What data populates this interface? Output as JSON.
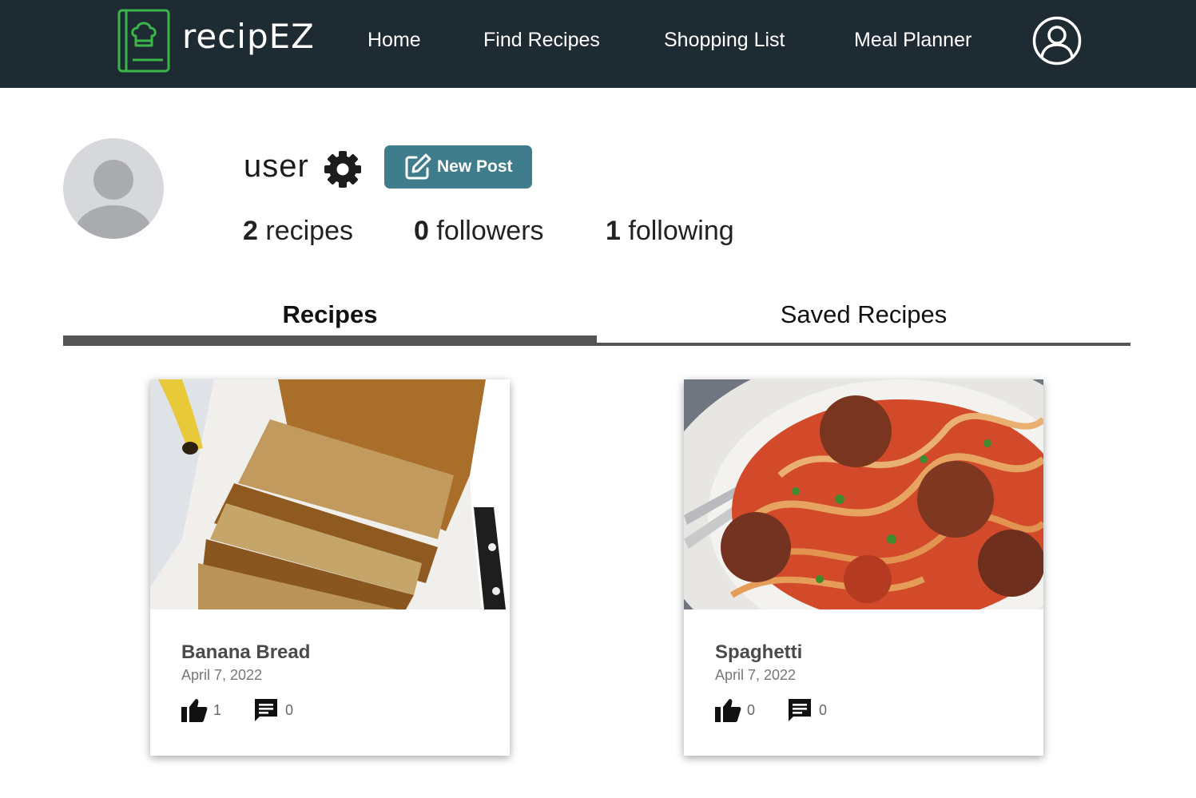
{
  "app": {
    "name": "recipEZ",
    "brand_color": "#3bb54a",
    "nav_bg": "#1f2b33",
    "accent": "#3f7d8c"
  },
  "nav": {
    "links": [
      {
        "label": "Home"
      },
      {
        "label": "Find Recipes"
      },
      {
        "label": "Shopping List"
      },
      {
        "label": "Meal Planner"
      }
    ],
    "account_icon": "account-circle-icon"
  },
  "profile": {
    "username": "user",
    "settings_icon": "gear-icon",
    "new_post_label": "New Post",
    "stats": {
      "recipes_count": "2",
      "recipes_label": "recipes",
      "followers_count": "0",
      "followers_label": "followers",
      "following_count": "1",
      "following_label": "following"
    }
  },
  "tabs": [
    {
      "label": "Recipes",
      "active": true
    },
    {
      "label": "Saved Recipes",
      "active": false
    }
  ],
  "recipes": [
    {
      "title": "Banana Bread",
      "date": "April 7, 2022",
      "likes": "1",
      "comments": "0",
      "image": "banana-bread-photo"
    },
    {
      "title": "Spaghetti",
      "date": "April 7, 2022",
      "likes": "0",
      "comments": "0",
      "image": "spaghetti-meatballs-photo"
    }
  ]
}
